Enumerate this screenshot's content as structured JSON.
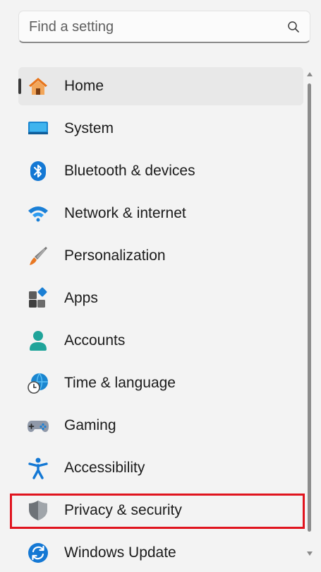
{
  "search": {
    "placeholder": "Find a setting",
    "value": ""
  },
  "nav": {
    "items": [
      {
        "label": "Home",
        "icon": "home-icon",
        "active": true
      },
      {
        "label": "System",
        "icon": "system-icon"
      },
      {
        "label": "Bluetooth & devices",
        "icon": "bluetooth-icon"
      },
      {
        "label": "Network & internet",
        "icon": "wifi-icon"
      },
      {
        "label": "Personalization",
        "icon": "brush-icon"
      },
      {
        "label": "Apps",
        "icon": "apps-icon"
      },
      {
        "label": "Accounts",
        "icon": "account-icon"
      },
      {
        "label": "Time & language",
        "icon": "globe-clock-icon"
      },
      {
        "label": "Gaming",
        "icon": "gamepad-icon"
      },
      {
        "label": "Accessibility",
        "icon": "accessibility-icon"
      },
      {
        "label": "Privacy & security",
        "icon": "shield-icon",
        "highlighted": true
      },
      {
        "label": "Windows Update",
        "icon": "update-icon"
      }
    ]
  },
  "colors": {
    "background": "#f3f3f3",
    "active_item": "#e8e8e8",
    "highlight_border": "#e0141e",
    "accent": "#0067c0"
  }
}
